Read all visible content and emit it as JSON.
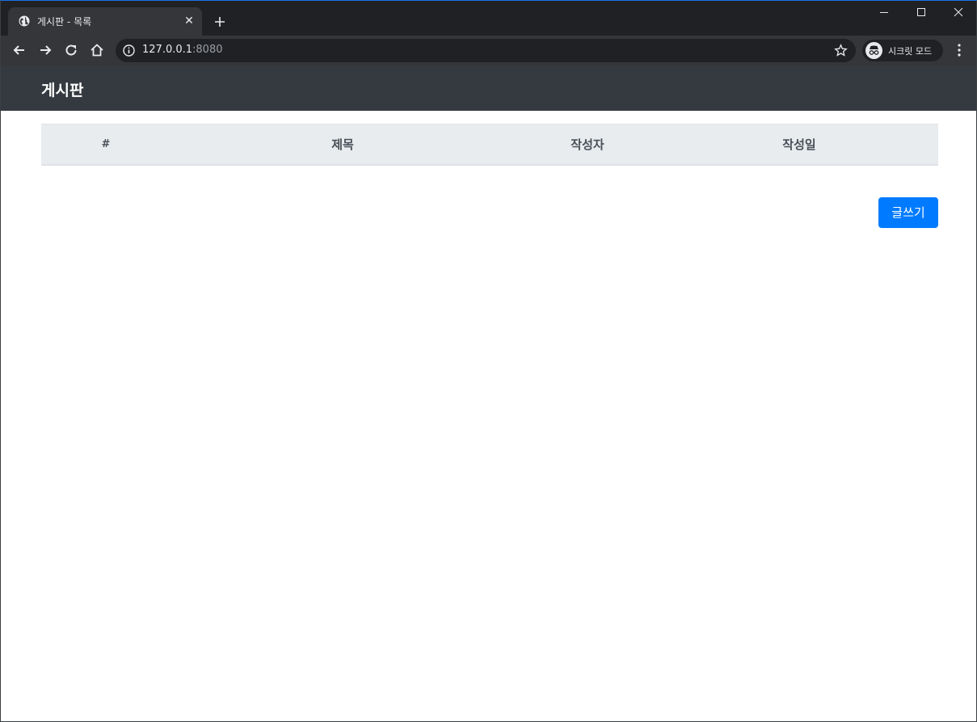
{
  "browser": {
    "tab": {
      "title": "게시판 - 목록",
      "close": "✕"
    },
    "address": {
      "host": "127.0.0.1",
      "port": ":8080"
    },
    "profile_label": "시크릿 모드"
  },
  "page": {
    "brand": "게시판",
    "table": {
      "headers": [
        "#",
        "제목",
        "작성자",
        "작성일"
      ],
      "rows": []
    },
    "write_button": "글쓰기"
  },
  "colors": {
    "navbar": "#343a40",
    "table_header_bg": "#e9ecef",
    "primary": "#007bff"
  }
}
